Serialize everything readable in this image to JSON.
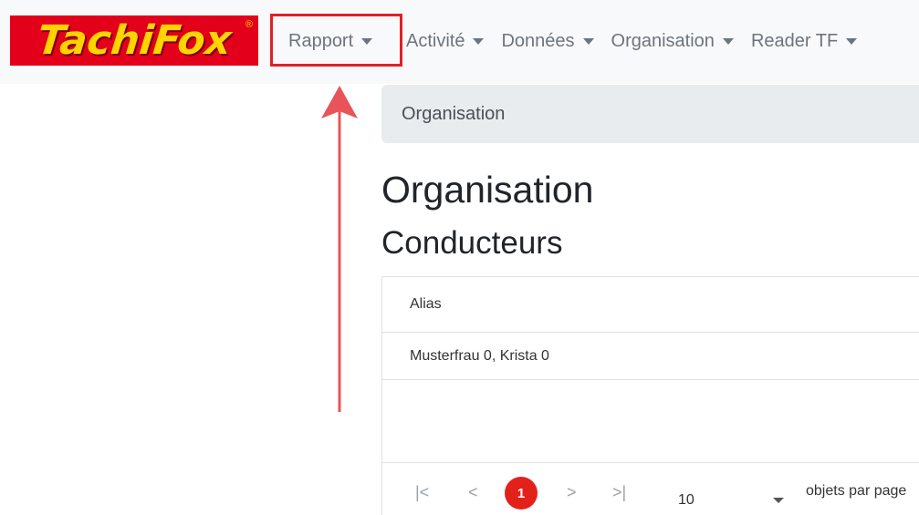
{
  "brand": {
    "name": "TachiFox",
    "reg": "®"
  },
  "nav": {
    "items": [
      {
        "label": "Rapport"
      },
      {
        "label": "Activité"
      },
      {
        "label": "Données"
      },
      {
        "label": "Organisation"
      },
      {
        "label": "Reader TF"
      }
    ]
  },
  "breadcrumb": {
    "current": "Organisation"
  },
  "page": {
    "title": "Organisation",
    "subtitle": "Conducteurs"
  },
  "grid": {
    "columns": [
      "Alias"
    ],
    "rows": [
      {
        "alias": "Musterfrau 0, Krista 0"
      }
    ]
  },
  "pager": {
    "first": "|<",
    "prev": "<",
    "current_page": "1",
    "next": ">",
    "last": ">|",
    "page_size": "10",
    "page_size_label": "objets par page"
  },
  "colors": {
    "accent": "#e3211b",
    "logo_bg": "#e3001b",
    "logo_text": "#ffd400",
    "annotation": "#e0202a"
  }
}
